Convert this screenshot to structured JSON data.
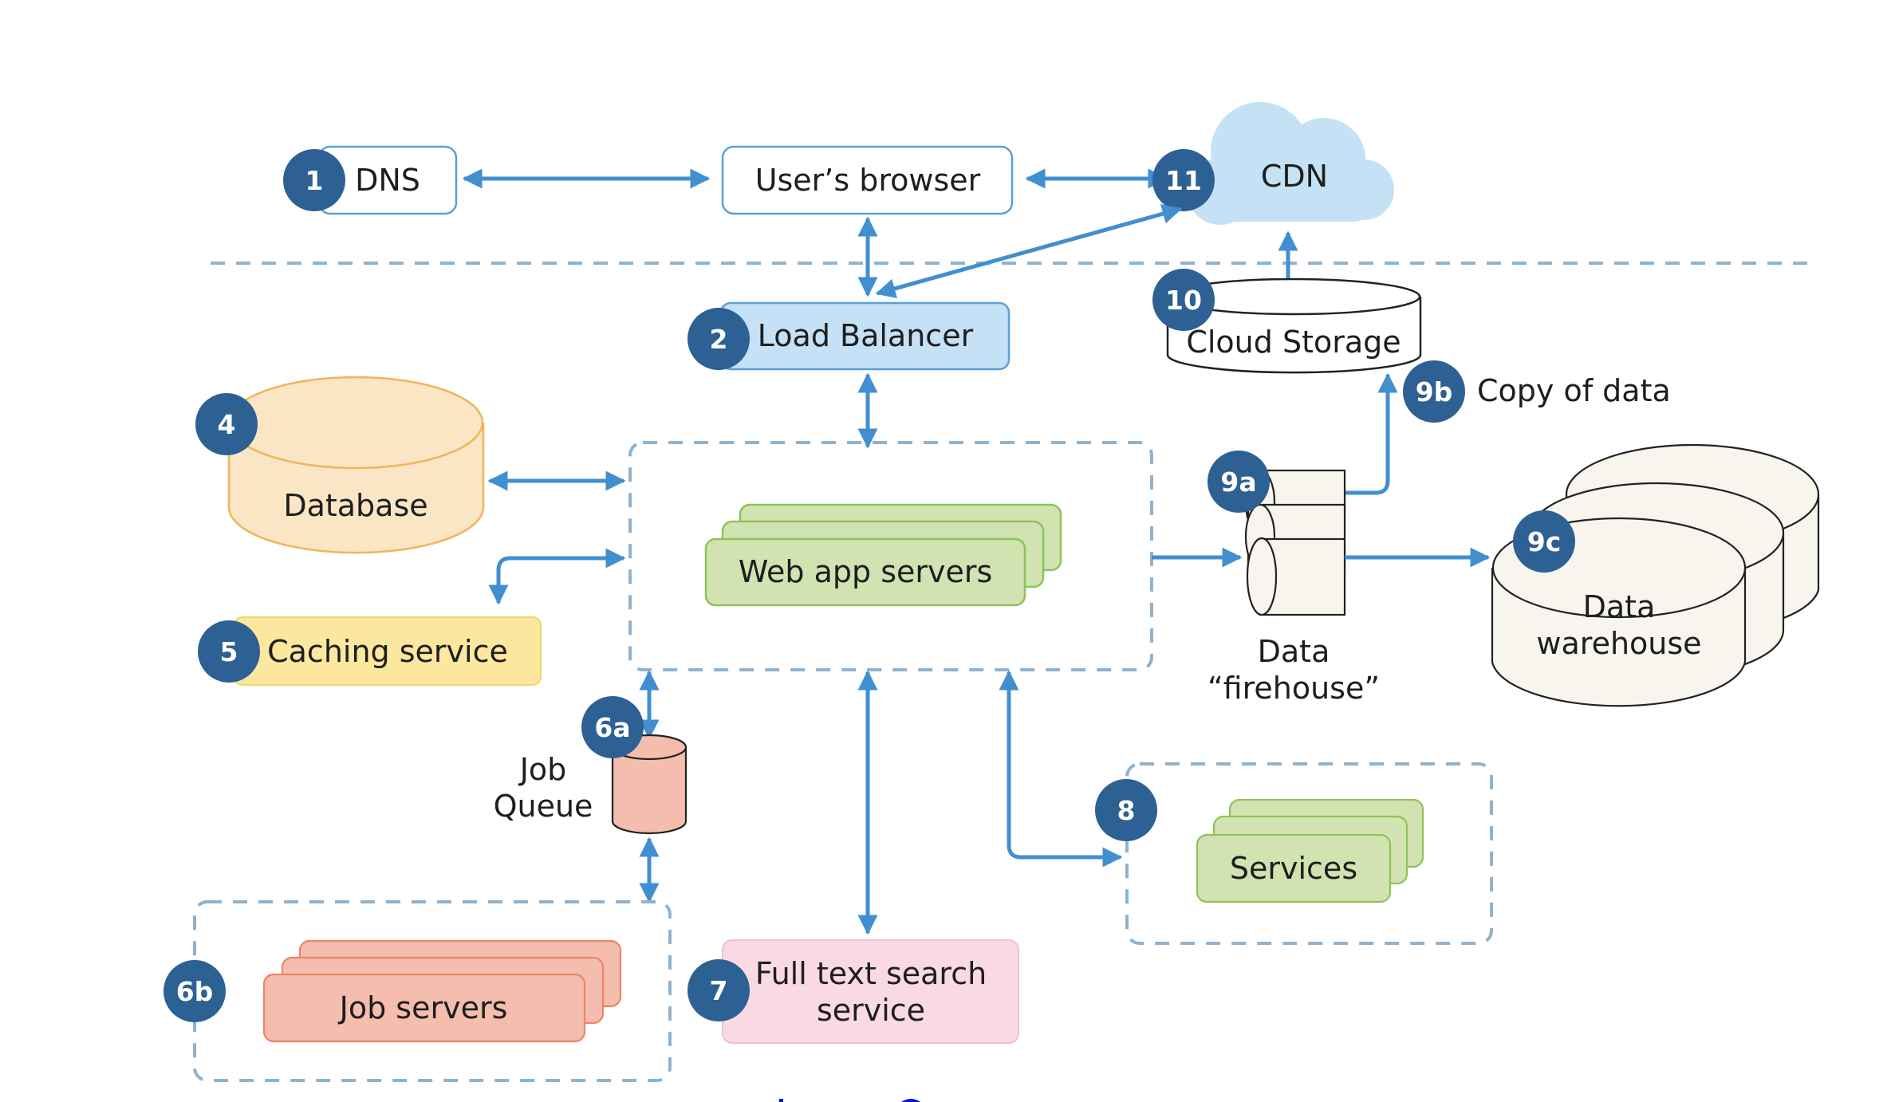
{
  "diagram": {
    "colors": {
      "badge": "#2d6093",
      "arrow": "#418fd0",
      "load_balancer": "#c5e1f5",
      "cdn": "#c5e1f5",
      "database": "#fae5c5",
      "caching": "#fbe79e",
      "web_servers": "#d0e3b0",
      "job_queue": "#f4bdad",
      "job_servers": "#f4bdad",
      "full_text": "#f9d9e4",
      "services": "#d0e3b0",
      "firehose": "#f7f5ee"
    },
    "nodes": {
      "dns": {
        "badge": "1",
        "label": "DNS"
      },
      "browser": {
        "label": "User’s browser"
      },
      "cdn": {
        "badge": "11",
        "label": "CDN"
      },
      "load_balancer": {
        "badge": "2",
        "label": "Load Balancer"
      },
      "cloud_storage": {
        "badge": "10",
        "label": "Cloud Storage"
      },
      "copy_of_data": {
        "badge": "9b",
        "label": "Copy of data"
      },
      "database": {
        "badge": "4",
        "label": "Database"
      },
      "web_app_servers": {
        "label": "Web app servers"
      },
      "caching": {
        "badge": "5",
        "label": "Caching service"
      },
      "firehose": {
        "badge": "9a",
        "label_line1": "Data",
        "label_line2": "“firehouse”"
      },
      "warehouse": {
        "badge": "9c",
        "label_line1": "Data",
        "label_line2": "warehouse"
      },
      "job_queue": {
        "badge": "6a",
        "label_line1": "Job",
        "label_line2": "Queue"
      },
      "job_servers": {
        "badge": "6b",
        "label": "Job servers"
      },
      "full_text": {
        "badge": "7",
        "label_line1": "Full text search",
        "label_line2": "service"
      },
      "services": {
        "badge": "8",
        "label": "Services"
      }
    }
  }
}
